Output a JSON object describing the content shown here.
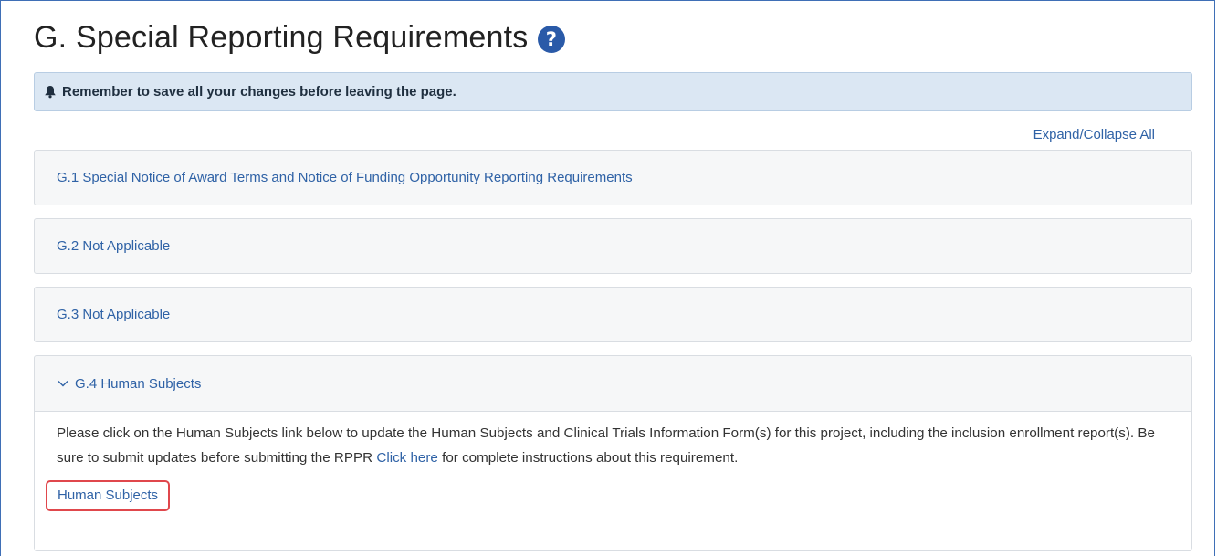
{
  "page": {
    "title": "G. Special Reporting Requirements",
    "help_icon": "question-circle-icon"
  },
  "alert": {
    "icon": "bell-icon",
    "text": "Remember to save all your changes before leaving the page."
  },
  "toolbar": {
    "expand_collapse_label": "Expand/Collapse All"
  },
  "sections": [
    {
      "label": "G.1 Special Notice of Award Terms and Notice of Funding Opportunity Reporting Requirements",
      "expanded": false
    },
    {
      "label": "G.2 Not Applicable",
      "expanded": false
    },
    {
      "label": "G.3 Not Applicable",
      "expanded": false
    },
    {
      "label": "G.4 Human Subjects",
      "expanded": true,
      "icon": "chevron-down-icon",
      "body_text_1": "Please click on the Human Subjects link below to update the Human Subjects and Clinical Trials Information Form(s) for this project, including the inclusion enrollment report(s). Be sure to submit updates before submitting the RPPR",
      "body_link": "Click here",
      "body_text_2": "for complete instructions about this requirement.",
      "action_link": "Human Subjects"
    }
  ],
  "colors": {
    "link": "#2f62a6",
    "alert_bg": "#dbe7f3",
    "highlight_box": "#e0474c",
    "help_icon": "#2a5aa8"
  }
}
